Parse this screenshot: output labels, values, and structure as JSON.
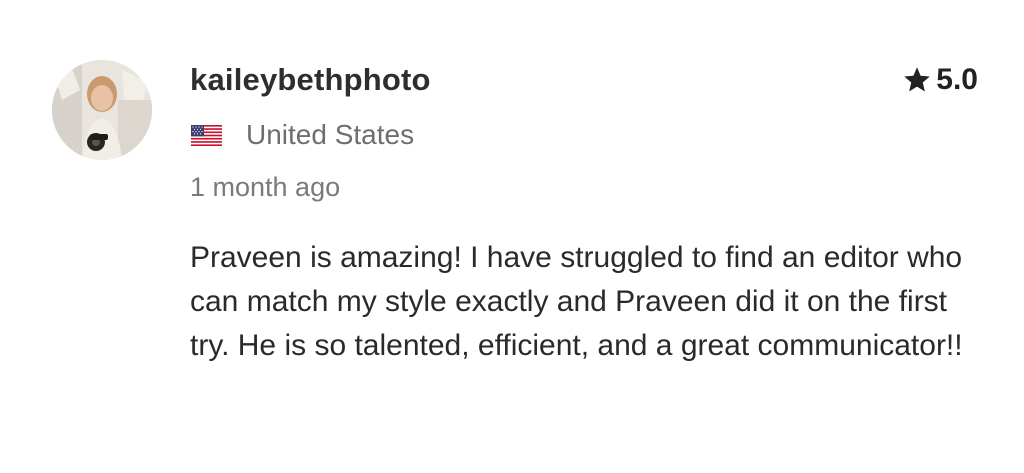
{
  "review": {
    "username": "kaileybethphoto",
    "country": "United States",
    "country_flag_icon": "us-flag-icon",
    "rating_icon": "star-icon",
    "rating": "5.0",
    "time_ago": "1 month ago",
    "text": "Praveen is amazing! I have struggled to find an editor who can match my style exactly and Praveen did it on the first try. He is so talented, efficient, and a great communicator!!"
  }
}
